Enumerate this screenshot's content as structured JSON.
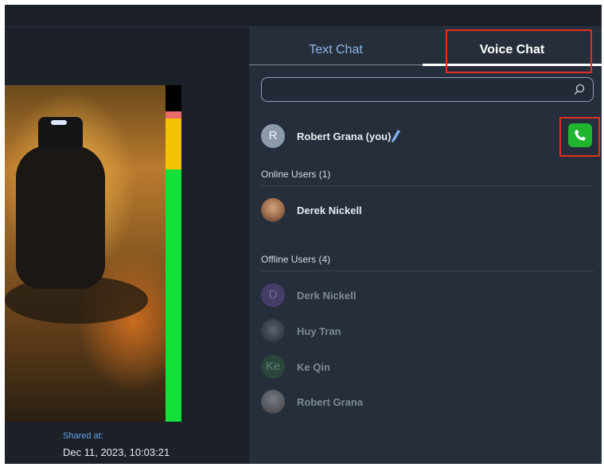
{
  "tabs": {
    "text_chat": "Text Chat",
    "voice_chat": "Voice Chat",
    "active": "voice_chat"
  },
  "search": {
    "placeholder": "",
    "value": "",
    "icon": "search-icon"
  },
  "current_user": {
    "initial": "R",
    "name": "Robert Grana (you)",
    "edit_icon": "pencil-icon",
    "call_icon": "phone-icon"
  },
  "online_section": {
    "title": "Online Users (1)",
    "users": [
      {
        "name": "Derek Nickell",
        "avatar": "photo"
      }
    ]
  },
  "offline_section": {
    "title": "Offline Users (4)",
    "users": [
      {
        "name": "Derk Nickell",
        "initial": "D",
        "avatar": "initial"
      },
      {
        "name": "Huy Tran",
        "avatar": "photo"
      },
      {
        "name": "Ke Qin",
        "initial": "Ke",
        "avatar": "initial"
      },
      {
        "name": "Robert Grana",
        "avatar": "photo"
      }
    ]
  },
  "media": {
    "shared_label": "Shared at:",
    "shared_time": "Dec 11, 2023, 10:03:21"
  },
  "colors": {
    "accent_blue": "#5fa3e6",
    "call_green": "#1fb62e",
    "highlight_red": "#e0301e",
    "vu_green": "#14e03a",
    "vu_yellow": "#f5c200",
    "vu_red": "#e96a6a"
  }
}
